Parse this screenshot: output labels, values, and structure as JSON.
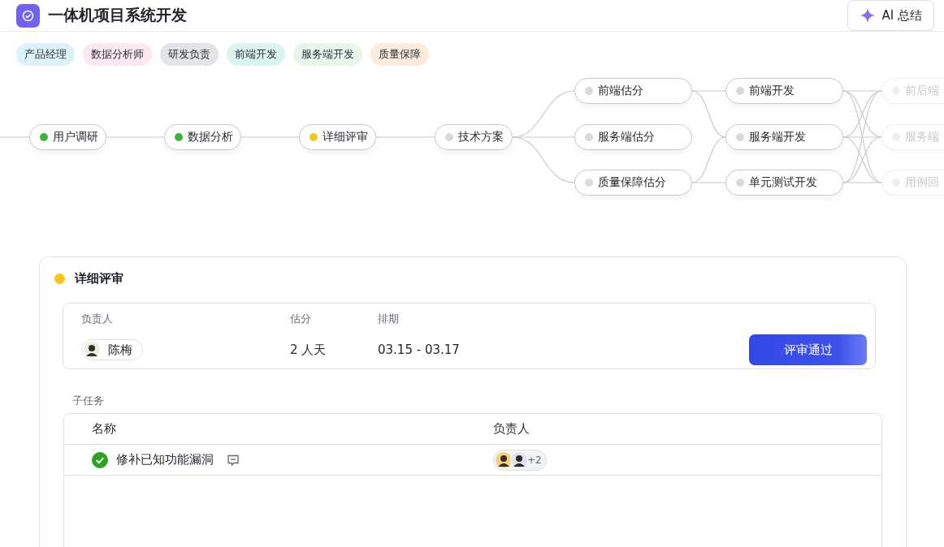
{
  "header": {
    "title": "一体机项目系统开发",
    "ai_button": "AI 总结"
  },
  "tags": [
    {
      "label": "产品经理",
      "color": "#dcf2fb"
    },
    {
      "label": "数据分析师",
      "color": "#fde8f1"
    },
    {
      "label": "研发负责",
      "color": "#e3e4e7"
    },
    {
      "label": "前端开发",
      "color": "#daf4f0"
    },
    {
      "label": "服务端开发",
      "color": "#e8f6ea"
    },
    {
      "label": "质量保障",
      "color": "#fdecdb"
    }
  ],
  "flow": {
    "columns": [
      [
        {
          "label": "用户调研",
          "color": "#3bb43a",
          "faded": false
        }
      ],
      [
        {
          "label": "数据分析",
          "color": "#3bb43a",
          "faded": false
        }
      ],
      [
        {
          "label": "详细评审",
          "color": "#fac415",
          "faded": false
        }
      ],
      [
        {
          "label": "技术方案",
          "color": "#d8d9de",
          "faded": false
        }
      ],
      [
        {
          "label": "前端估分",
          "color": "#d8d9de",
          "faded": false
        },
        {
          "label": "服务端估分",
          "color": "#d8d9de",
          "faded": false
        },
        {
          "label": "质量保障估分",
          "color": "#d8d9de",
          "faded": false
        }
      ],
      [
        {
          "label": "前端开发",
          "color": "#d8d9de",
          "faded": false
        },
        {
          "label": "服务端开发",
          "color": "#d8d9de",
          "faded": false
        },
        {
          "label": "单元测试开发",
          "color": "#d8d9de",
          "faded": false
        }
      ],
      [
        {
          "label": "前后端",
          "color": "#eeeff1",
          "faded": true
        },
        {
          "label": "服务端",
          "color": "#eeeff1",
          "faded": true
        },
        {
          "label": "用例回",
          "color": "#eeeff1",
          "faded": true
        }
      ]
    ]
  },
  "detail": {
    "title": "详细评审",
    "color": "#fac415",
    "info": {
      "columns": [
        "负责人",
        "估分",
        "排期"
      ],
      "owner": "陈梅",
      "estimate": "2 人天",
      "schedule": "03.15 - 03.17",
      "action": "评审通过"
    },
    "subtasks": {
      "label": "子任务",
      "columns": [
        "名称",
        "负责人"
      ],
      "rows": [
        {
          "name": "修补已知功能漏洞",
          "done": true,
          "extra_count": "+2"
        }
      ]
    }
  }
}
